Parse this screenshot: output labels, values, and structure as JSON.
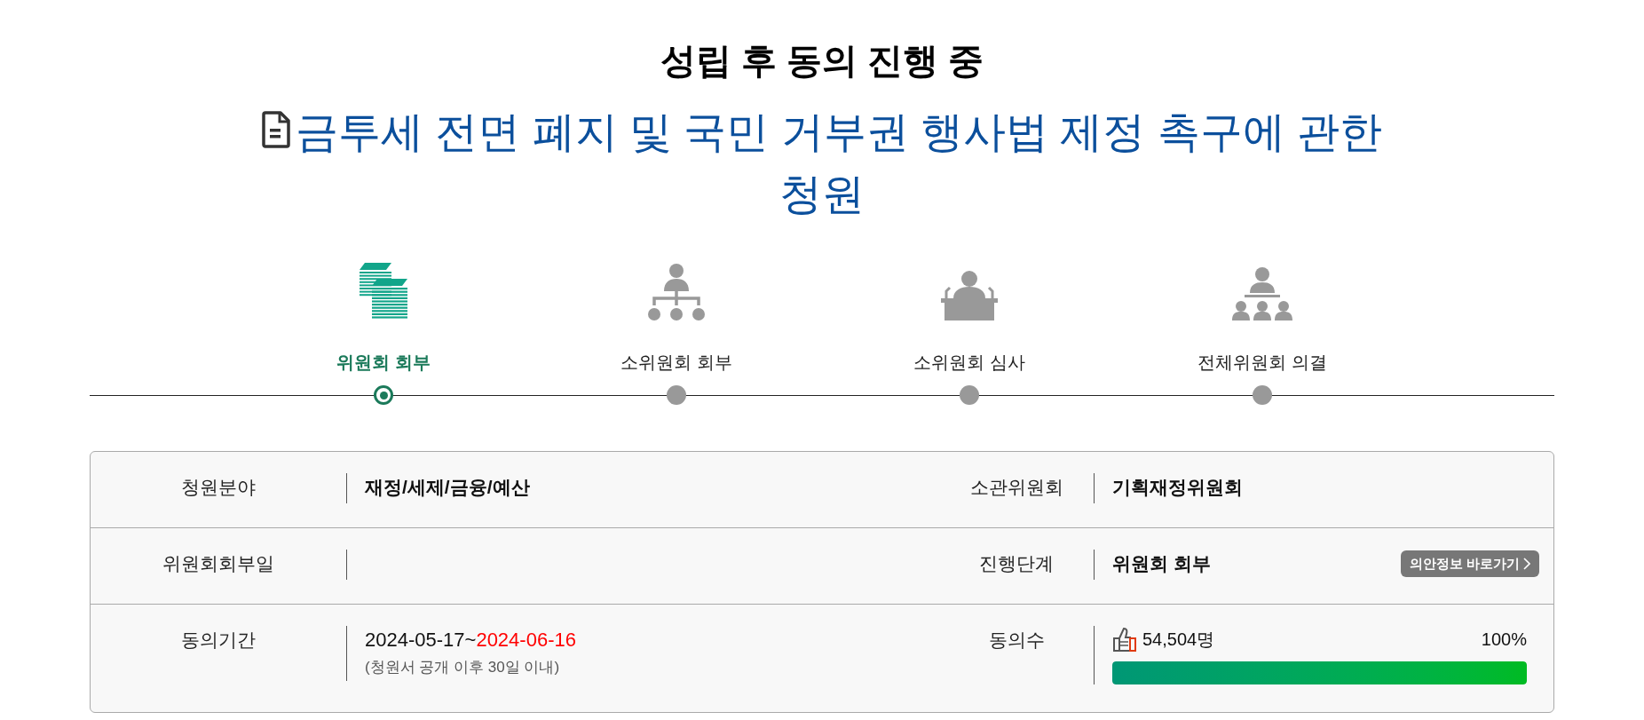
{
  "status_heading": "성립 후 동의 진행 중",
  "petition_title": "금투세 전면 폐지 및 국민 거부권 행사법 제정 촉구에 관한 청원",
  "steps": [
    {
      "label": "위원회 회부",
      "selected": true
    },
    {
      "label": "소위원회 회부",
      "selected": false
    },
    {
      "label": "소위원회 심사",
      "selected": false
    },
    {
      "label": "전체위원회 의결",
      "selected": false
    }
  ],
  "details": [
    {
      "left": {
        "label": "청원분야",
        "kind": "text",
        "value": "재정/세제/금융/예산"
      },
      "right": {
        "label": "소관위원회",
        "kind": "text",
        "value": "기획재정위원회"
      }
    },
    {
      "left": {
        "label": "위원회회부일",
        "kind": "empty"
      },
      "right": {
        "label": "진행단계",
        "kind": "stage",
        "value": "위원회 회부",
        "link": "의안정보 바로가기"
      }
    },
    {
      "left": {
        "label": "동의기간",
        "kind": "period",
        "start": "2024-05-17",
        "separator": "~",
        "end": "2024-06-16",
        "note": "(청원서 공개 이후 30일 이내)"
      },
      "right": {
        "label": "동의수",
        "kind": "count",
        "count": "54,504명",
        "percent": "100%",
        "level": 1
      }
    }
  ]
}
